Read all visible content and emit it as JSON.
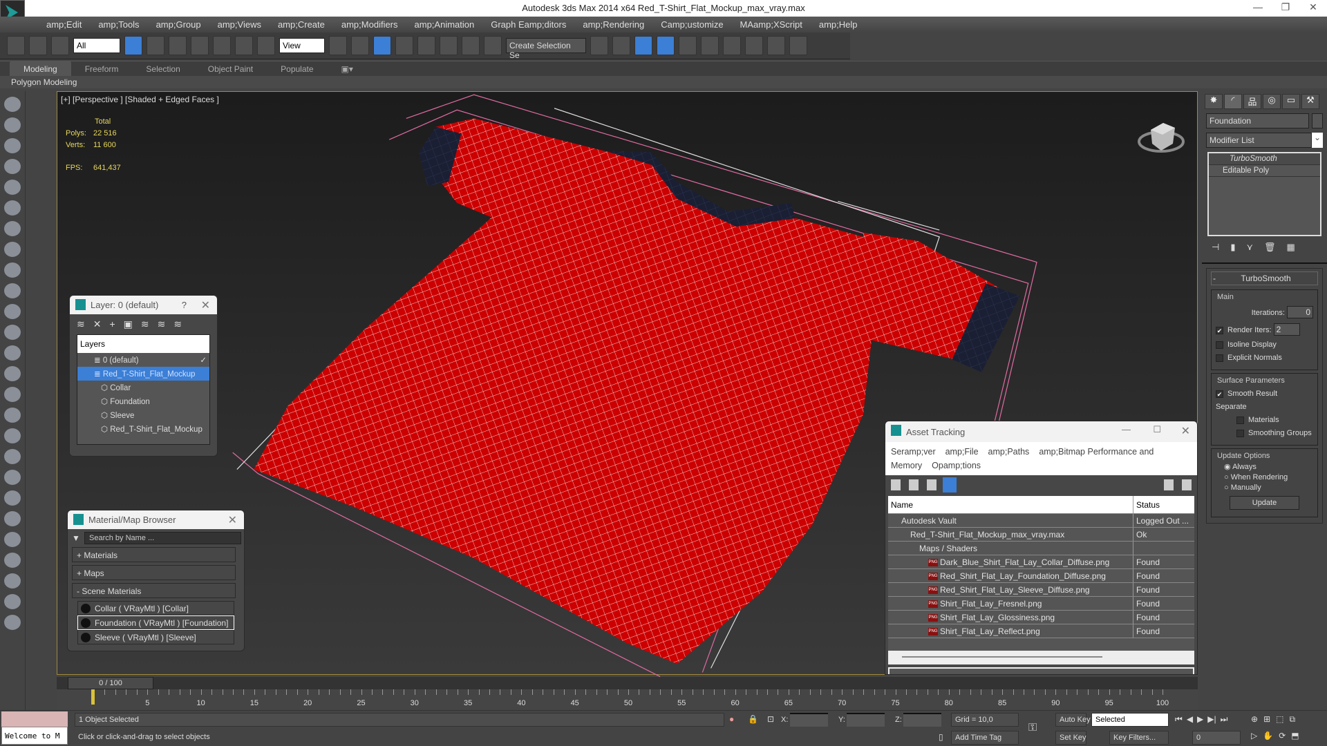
{
  "window": {
    "title": "Autodesk 3ds Max  2014 x64     Red_T-Shirt_Flat_Mockup_max_vray.max"
  },
  "menu": [
    "amp;Edit",
    "amp;Tools",
    "amp;Group",
    "amp;Views",
    "amp;Create",
    "amp;Modifiers",
    "amp;Animation",
    "Graph Eamp;ditors",
    "amp;Rendering",
    "Camp;ustomize",
    "MAamp;XScript",
    "amp;Help"
  ],
  "toolbar": {
    "selection_filter": "All",
    "ref_coord": "View",
    "named_selection": "Create Selection Se"
  },
  "ribbon": {
    "tabs": [
      "Modeling",
      "Freeform",
      "Selection",
      "Object Paint",
      "Populate"
    ],
    "active": "Modeling",
    "sub": "Polygon Modeling"
  },
  "viewport": {
    "label": "[+] [Perspective ] [Shaded + Edged Faces ]",
    "stats": {
      "total_label": "Total",
      "polys_label": "Polys:",
      "polys": "22 516",
      "verts_label": "Verts:",
      "verts": "11 600",
      "fps_label": "FPS:",
      "fps": "641,437"
    }
  },
  "command_panel": {
    "object_name": "Foundation",
    "modifier_list": "Modifier List",
    "stack": [
      "TurboSmooth",
      "Editable Poly"
    ],
    "turbosmooth": {
      "title": "TurboSmooth",
      "main": "Main",
      "iterations_label": "Iterations:",
      "iterations": "0",
      "render_iters_label": "Render Iters:",
      "render_iters": "2",
      "render_iters_checked": true,
      "isoline": "Isoline Display",
      "explicit": "Explicit Normals",
      "surface": "Surface Parameters",
      "smooth_result": "Smooth Result",
      "smooth_checked": true,
      "separate": "Separate",
      "materials": "Materials",
      "smoothing_groups": "Smoothing Groups",
      "update_options": "Update Options",
      "always": "Always",
      "when_rendering": "When Rendering",
      "manually": "Manually",
      "selected_option": "Always",
      "update": "Update"
    }
  },
  "layer_window": {
    "title": "Layer: 0 (default)",
    "help": "?",
    "header": "Layers",
    "rows": [
      {
        "label": "0 (default)"
      },
      {
        "label": "Red_T-Shirt_Flat_Mockup",
        "selected": true
      },
      {
        "label": "Collar"
      },
      {
        "label": "Foundation"
      },
      {
        "label": "Sleeve"
      },
      {
        "label": "Red_T-Shirt_Flat_Mockup"
      }
    ]
  },
  "material_browser": {
    "title": "Material/Map Browser",
    "search_placeholder": "Search by Name ...",
    "sections": [
      "+ Materials",
      "+ Maps",
      "- Scene Materials"
    ],
    "materials": [
      "Collar  ( VRayMtl )  [Collar]",
      "Foundation  ( VRayMtl )  [Foundation]",
      "Sleeve  ( VRayMtl )  [Sleeve]"
    ],
    "selected": "Foundation  ( VRayMtl )  [Foundation]"
  },
  "asset_tracking": {
    "title": "Asset Tracking",
    "menu": [
      "Seramp;ver",
      "amp;File",
      "amp;Paths",
      "amp;Bitmap Performance and Memory",
      "Opamp;tions"
    ],
    "columns": [
      "Name",
      "Status"
    ],
    "rows": [
      {
        "name": "Autodesk Vault",
        "status": "Logged Out ...",
        "indent": 1
      },
      {
        "name": "Red_T-Shirt_Flat_Mockup_max_vray.max",
        "status": "Ok",
        "indent": 2
      },
      {
        "name": "Maps / Shaders",
        "status": "",
        "indent": 3
      },
      {
        "name": "Dark_Blue_Shirt_Flat_Lay_Collar_Diffuse.png",
        "status": "Found",
        "indent": 4,
        "png": true
      },
      {
        "name": "Red_Shirt_Flat_Lay_Foundation_Diffuse.png",
        "status": "Found",
        "indent": 4,
        "png": true
      },
      {
        "name": "Red_Shirt_Flat_Lay_Sleeve_Diffuse.png",
        "status": "Found",
        "indent": 4,
        "png": true
      },
      {
        "name": "Shirt_Flat_Lay_Fresnel.png",
        "status": "Found",
        "indent": 4,
        "png": true
      },
      {
        "name": "Shirt_Flat_Lay_Glossiness.png",
        "status": "Found",
        "indent": 4,
        "png": true
      },
      {
        "name": "Shirt_Flat_Lay_Reflect.png",
        "status": "Found",
        "indent": 4,
        "png": true
      }
    ]
  },
  "timeline": {
    "frame": "0 / 100",
    "ticks": [
      "0",
      "5",
      "10",
      "15",
      "20",
      "25",
      "30",
      "35",
      "40",
      "45",
      "50",
      "55",
      "60",
      "65",
      "70",
      "75",
      "80",
      "85",
      "90",
      "95",
      "100"
    ]
  },
  "status": {
    "welcome": "Welcome to M",
    "selected": "1 Object Selected",
    "prompt": "Click or click-and-drag to select objects",
    "x_label": "X:",
    "y_label": "Y:",
    "z_label": "Z:",
    "grid": "Grid = 10,0",
    "add_time_tag": "Add Time Tag",
    "auto_key": "Auto Key",
    "set_key": "Set Key",
    "key_mode": "Selected",
    "key_filters": "Key Filters...",
    "current_frame": "0"
  },
  "colors": {
    "shirt": "#d10000",
    "collar": "#1a1f33",
    "selection_box": "#e06aa0",
    "accent": "#3b7fd6"
  }
}
